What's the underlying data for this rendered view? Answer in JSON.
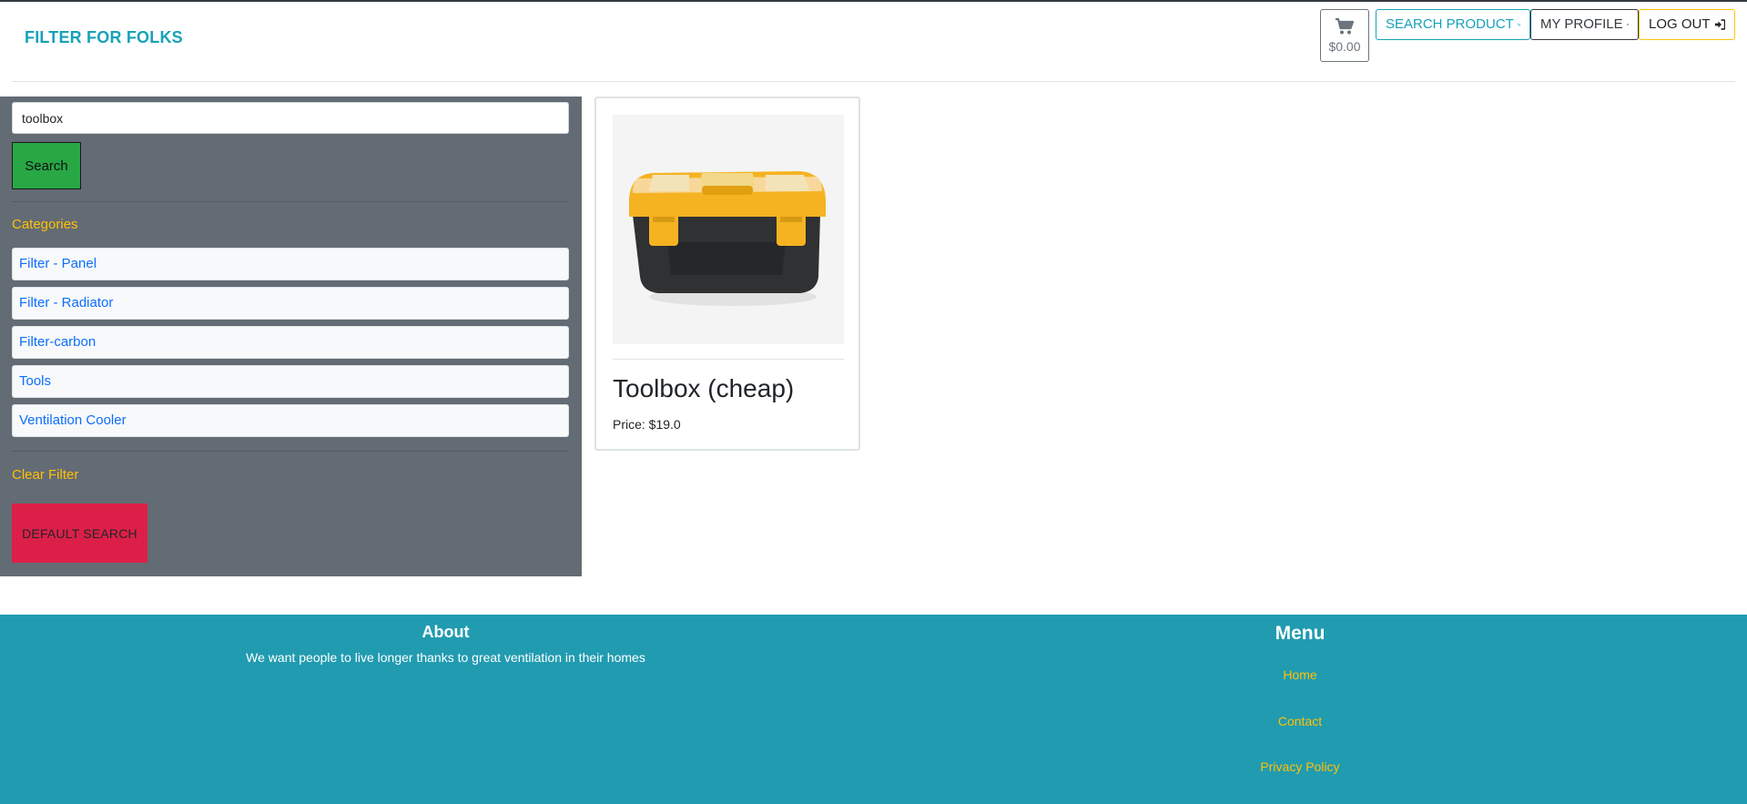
{
  "header": {
    "brand": "FILTER FOR FOLKS",
    "cart_total": "$0.00",
    "search_product_label": "SEARCH PRODUCT",
    "my_profile_label": "MY PROFILE",
    "logout_label": "LOG OUT"
  },
  "sidebar": {
    "search_value": "toolbox",
    "search_button": "Search",
    "categories_heading": "Categories",
    "categories": [
      {
        "label": "Filter - Panel"
      },
      {
        "label": "Filter - Radiator"
      },
      {
        "label": "Filter-carbon"
      },
      {
        "label": "Tools"
      },
      {
        "label": "Ventilation Cooler"
      }
    ],
    "clear_filter": "Clear Filter",
    "default_search_button": "DEFAULT SEARCH"
  },
  "products": [
    {
      "title": "Toolbox (cheap)",
      "price": "Price: $19.0"
    }
  ],
  "footer": {
    "about_title": "About",
    "about_text": "We want people to live longer thanks to great ventilation in their homes",
    "menu_title": "Menu",
    "menu_links": [
      {
        "label": "Home"
      },
      {
        "label": "Contact"
      },
      {
        "label": "Privacy Policy"
      }
    ]
  },
  "colors": {
    "brand": "#17a2b8",
    "accent": "#ffc107",
    "sidebar_bg": "#636b74",
    "search_button": "#28a745",
    "default_search_button": "#dc1f48",
    "footer_bg": "#219bb0",
    "category_link": "#0d6efd"
  },
  "icons": {
    "cart": "cart-icon",
    "search": "search-icon",
    "profile": "user-circle-icon",
    "logout": "sign-in-icon"
  }
}
